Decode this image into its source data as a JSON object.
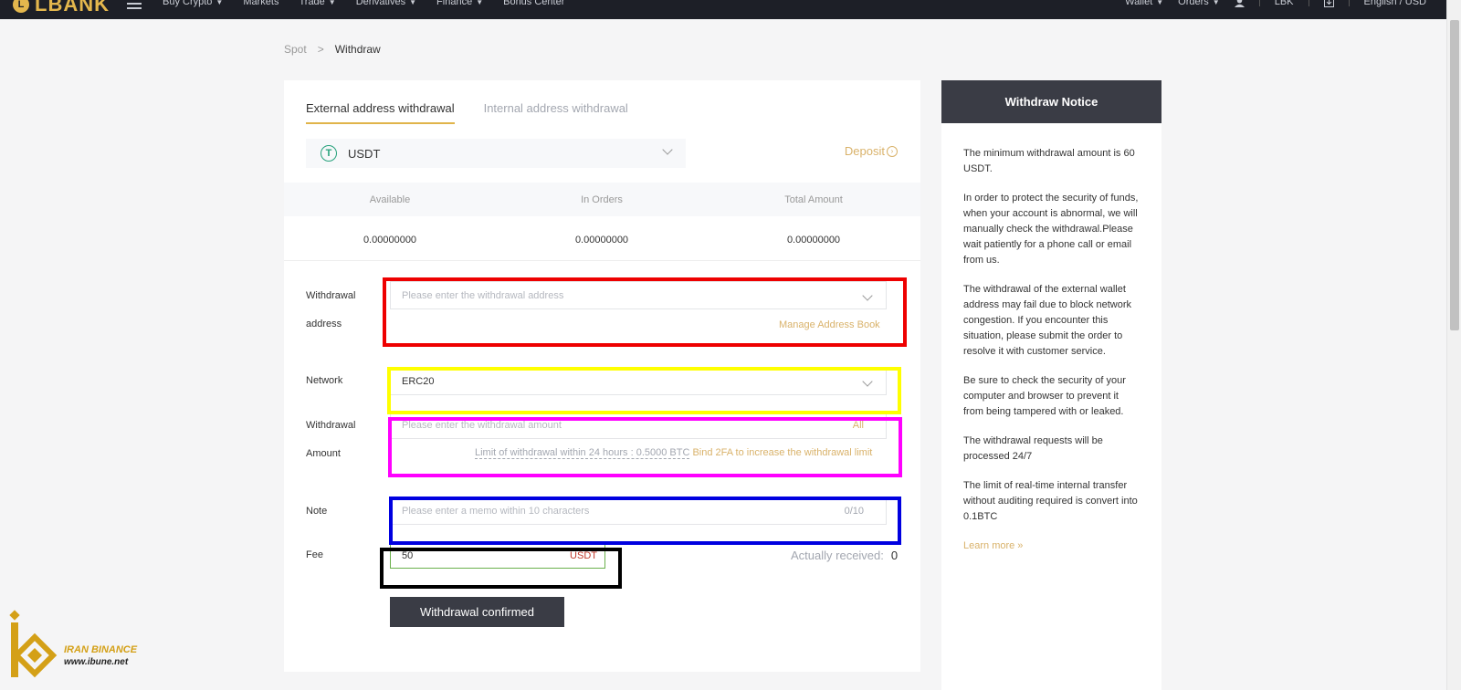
{
  "nav": {
    "logo_text": "LBANK",
    "logo_mark": "L",
    "items": [
      {
        "label": "Buy Crypto",
        "dropdown": true
      },
      {
        "label": "Markets",
        "dropdown": false
      },
      {
        "label": "Trade",
        "dropdown": true
      },
      {
        "label": "Derivatives",
        "dropdown": true
      },
      {
        "label": "Finance",
        "dropdown": true
      },
      {
        "label": "Bonus Center",
        "dropdown": false
      }
    ],
    "right": {
      "wallet": "Wallet",
      "orders": "Orders",
      "user_icon": "user-icon",
      "lbk": "LBK",
      "download_icon": "download-icon",
      "language": "English / USD"
    }
  },
  "breadcrumb": {
    "parent": "Spot",
    "arrow": ">",
    "current": "Withdraw"
  },
  "tabs": {
    "external": "External address withdrawal",
    "internal": "Internal address withdrawal"
  },
  "coin": {
    "symbol_glyph": "T",
    "name": "USDT"
  },
  "deposit_label": "Deposit",
  "balances": {
    "headers": [
      "Available",
      "In Orders",
      "Total Amount"
    ],
    "values": [
      "0.00000000",
      "0.00000000",
      "0.00000000"
    ]
  },
  "form": {
    "address": {
      "label_line1": "Withdrawal",
      "label_line2": "address",
      "placeholder": "Please enter the withdrawal address",
      "manage_link": "Manage Address Book"
    },
    "network": {
      "label": "Network",
      "value": "ERC20"
    },
    "amount": {
      "label_line1": "Withdrawal",
      "label_line2": "Amount",
      "placeholder": "Please enter the withdrawal amount",
      "all_link": "All",
      "limit_prefix": "Limit of withdrawal within 24 hours :",
      "limit_value": "0.5000 BTC",
      "limit_link": "Bind 2FA to increase the withdrawal limit"
    },
    "note": {
      "label": "Note",
      "placeholder": "Please enter a memo within 10 characters",
      "counter": "0/10"
    },
    "fee": {
      "label": "Fee",
      "value": "50",
      "unit": "USDT",
      "received_label": "Actually received:",
      "received_value": "0"
    },
    "confirm_button": "Withdrawal confirmed"
  },
  "notice": {
    "title": "Withdraw Notice",
    "paragraphs": [
      "The minimum withdrawal amount is 60 USDT.",
      "In order to protect the security of funds, when your account is abnormal, we will manually check the withdrawal.Please wait patiently for a phone call or email from us.",
      "The withdrawal of the external wallet address may fail due to block network congestion. If you encounter this situation, please submit the order to resolve it with customer service.",
      "Be sure to check the security of your computer and browser to prevent it from being tampered with or leaked.",
      "The withdrawal requests will be processed 24/7",
      "The limit of real-time internal transfer without auditing required is convert into 0.1BTC"
    ],
    "learn_more": "Learn more »"
  },
  "watermark": {
    "line1": "IRAN BINANCE",
    "line2": "www.ibune.net"
  },
  "colors": {
    "accent_gold": "#d9b26a",
    "nav_bg": "#1d1f27",
    "button_dark": "#3a3c45",
    "highlight_red": "#e00000",
    "highlight_yellow": "#ffff00",
    "highlight_magenta": "#ff00ff",
    "highlight_blue": "#0000e0",
    "highlight_black": "#000000"
  }
}
